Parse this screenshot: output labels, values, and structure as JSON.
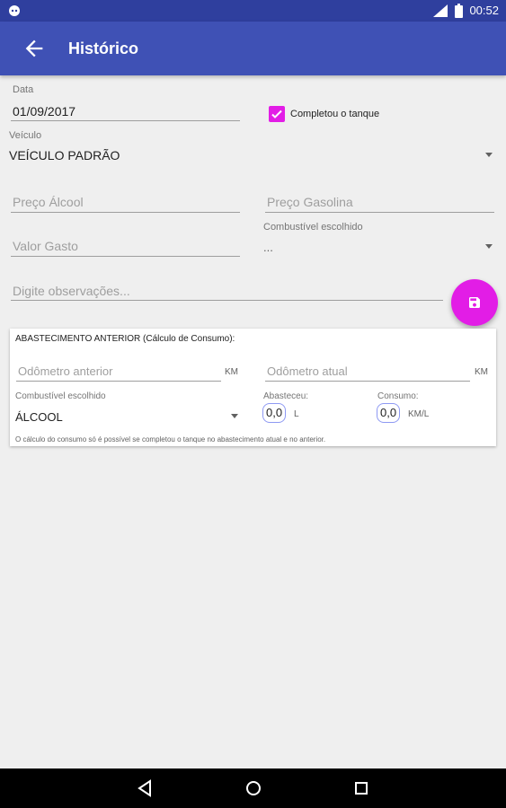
{
  "status": {
    "time": "00:52"
  },
  "header": {
    "title": "Histórico"
  },
  "form": {
    "date_label": "Data",
    "date_value": "01/09/2017",
    "tank_full_label": "Completou o tanque",
    "vehicle_label": "Veículo",
    "vehicle_value": "VEÍCULO PADRÃO",
    "price_alcohol_placeholder": "Preço Álcool",
    "price_gasoline_placeholder": "Preço Gasolina",
    "fuel_chosen_label": "Combustível escolhido",
    "fuel_chosen_value": "...",
    "amount_spent_placeholder": "Valor Gasto",
    "notes_placeholder": "Digite observações..."
  },
  "previous": {
    "title": "ABASTECIMENTO ANTERIOR (Cálculo de Consumo):",
    "odo_prev_placeholder": "Odômetro anterior",
    "odo_prev_unit": "KM",
    "odo_curr_placeholder": "Odômetro atual",
    "odo_curr_unit": "KM",
    "fuel_label": "Combustível escolhido",
    "fuel_value": "ÁLCOOL",
    "fueled_label": "Abasteceu:",
    "fueled_value": "0,0",
    "fueled_unit": "L",
    "consumption_label": "Consumo:",
    "consumption_value": "0,0",
    "consumption_unit": "KM/L",
    "note": "O cálculo do consumo só é possível se completou o tanque no abastecimento atual e no anterior."
  },
  "colors": {
    "appbar": "#3f51b5",
    "statusbar": "#2f3f9e",
    "accent": "#e21de6"
  },
  "icons": [
    "back-arrow-icon",
    "checkbox-checked-icon",
    "dropdown-arrow-icon",
    "save-icon",
    "nav-back-icon",
    "nav-home-icon",
    "nav-recents-icon"
  ]
}
